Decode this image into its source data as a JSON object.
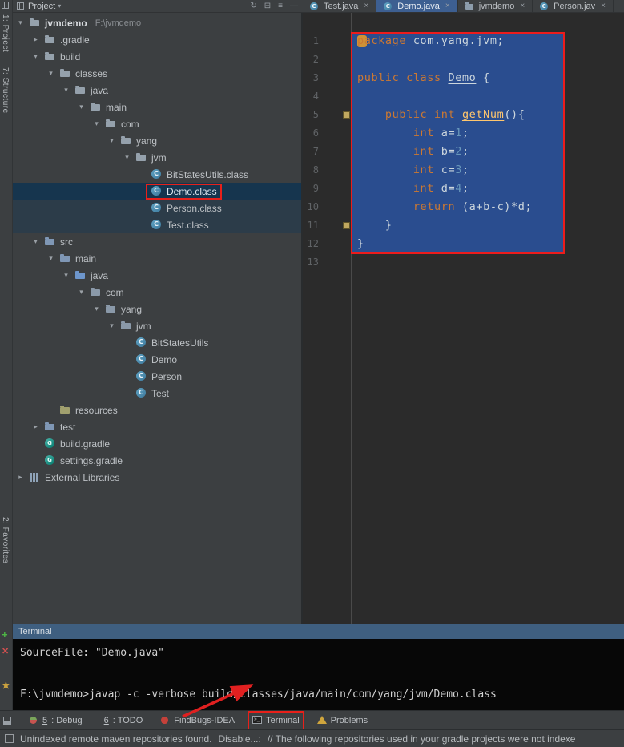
{
  "colors": {
    "accent_red": "#e8201a",
    "selection_blue": "#2a4d8f",
    "tree_selection": "#16354e",
    "keyword": "#cc7832",
    "number": "#6897bb",
    "method": "#ffc66d"
  },
  "icons": {
    "arrow_open": "▾",
    "arrow_closed": "▸"
  },
  "stripe": {
    "buttons": [
      {
        "label": "1: Project"
      },
      {
        "label": "7: Structure"
      },
      {
        "label": "2: Favorites"
      }
    ],
    "terminal_actions": [
      {
        "name": "add-icon",
        "glyph": "+"
      },
      {
        "name": "close-icon",
        "glyph": "✕"
      },
      {
        "name": "favorites-star-icon",
        "glyph": "★"
      }
    ]
  },
  "project_header": {
    "title": "Project",
    "caret": "▾",
    "actions": [
      {
        "name": "sync-icon",
        "glyph": "↻"
      },
      {
        "name": "collapse-all-icon",
        "glyph": "⊟"
      },
      {
        "name": "settings-icon",
        "glyph": "≡"
      },
      {
        "name": "hide-icon",
        "glyph": "—"
      }
    ]
  },
  "tabs": [
    {
      "label": "Test.java",
      "close": "×",
      "active": false,
      "icon": "class"
    },
    {
      "label": "Demo.java",
      "close": "×",
      "active": true,
      "icon": "class"
    },
    {
      "label": "jvmdemo",
      "close": "×",
      "active": false,
      "icon": "folder"
    },
    {
      "label": "Person.jav",
      "close": "×",
      "active": false,
      "icon": "class"
    }
  ],
  "tree": [
    {
      "label": "jvmdemo",
      "hint": "F:\\jvmdemo",
      "level": 0,
      "icon": "folder",
      "arrow": "open",
      "bold": true
    },
    {
      "label": ".gradle",
      "level": 1,
      "icon": "folder",
      "arrow": "closed"
    },
    {
      "label": "build",
      "level": 1,
      "icon": "folder",
      "arrow": "open"
    },
    {
      "label": "classes",
      "level": 2,
      "icon": "folder",
      "arrow": "open"
    },
    {
      "label": "java",
      "level": 3,
      "icon": "folder",
      "arrow": "open"
    },
    {
      "label": "main",
      "level": 4,
      "icon": "folder",
      "arrow": "open"
    },
    {
      "label": "com",
      "level": 5,
      "icon": "folder",
      "arrow": "open"
    },
    {
      "label": "yang",
      "level": 6,
      "icon": "folder",
      "arrow": "open"
    },
    {
      "label": "jvm",
      "level": 7,
      "icon": "folder",
      "arrow": "open"
    },
    {
      "label": "BitStatesUtils.class",
      "level": 8,
      "icon": "class"
    },
    {
      "label": "Demo.class",
      "level": 8,
      "icon": "class",
      "selected": true,
      "annotated": true
    },
    {
      "label": "Person.class",
      "level": 8,
      "icon": "class",
      "tinted": true
    },
    {
      "label": "Test.class",
      "level": 8,
      "icon": "class",
      "tinted": true
    },
    {
      "label": "src",
      "level": 1,
      "icon": "folder-src",
      "arrow": "open"
    },
    {
      "label": "main",
      "level": 2,
      "icon": "folder-src",
      "arrow": "open"
    },
    {
      "label": "java",
      "level": 3,
      "icon": "folder-root",
      "arrow": "open"
    },
    {
      "label": "com",
      "level": 4,
      "icon": "package",
      "arrow": "open"
    },
    {
      "label": "yang",
      "level": 5,
      "icon": "package",
      "arrow": "open"
    },
    {
      "label": "jvm",
      "level": 6,
      "icon": "package",
      "arrow": "open"
    },
    {
      "label": "BitStatesUtils",
      "level": 7,
      "icon": "class"
    },
    {
      "label": "Demo",
      "level": 7,
      "icon": "class"
    },
    {
      "label": "Person",
      "level": 7,
      "icon": "class"
    },
    {
      "label": "Test",
      "level": 7,
      "icon": "class"
    },
    {
      "label": "resources",
      "level": 2,
      "icon": "folder-resources"
    },
    {
      "label": "test",
      "level": 1,
      "icon": "folder-src",
      "arrow": "closed"
    },
    {
      "label": "build.gradle",
      "level": 1,
      "icon": "gradle"
    },
    {
      "label": "settings.gradle",
      "level": 1,
      "icon": "gradle"
    },
    {
      "label": "External Libraries",
      "level": 0,
      "icon": "library",
      "arrow": "closed"
    }
  ],
  "editor": {
    "lines": [
      {
        "n": "1",
        "segs": [
          [
            "kw",
            "package"
          ],
          [
            "pl",
            " com.yang.jvm;"
          ]
        ]
      },
      {
        "n": "2",
        "segs": []
      },
      {
        "n": "3",
        "segs": [
          [
            "kw",
            "public class"
          ],
          [
            "pl",
            " "
          ],
          [
            "cls",
            "Demo"
          ],
          [
            "pl",
            " {"
          ]
        ]
      },
      {
        "n": "4",
        "segs": []
      },
      {
        "n": "5",
        "segs": [
          [
            "pl",
            "    "
          ],
          [
            "kw",
            "public int"
          ],
          [
            "pl",
            " "
          ],
          [
            "mth",
            "getNum"
          ],
          [
            "pl",
            "(){"
          ]
        ]
      },
      {
        "n": "6",
        "segs": [
          [
            "pl",
            "        "
          ],
          [
            "kw",
            "int"
          ],
          [
            "pl",
            " a="
          ],
          [
            "num",
            "1"
          ],
          [
            "pl",
            ";"
          ]
        ]
      },
      {
        "n": "7",
        "segs": [
          [
            "pl",
            "        "
          ],
          [
            "kw",
            "int"
          ],
          [
            "pl",
            " b="
          ],
          [
            "num",
            "2"
          ],
          [
            "pl",
            ";"
          ]
        ]
      },
      {
        "n": "8",
        "segs": [
          [
            "pl",
            "        "
          ],
          [
            "kw",
            "int"
          ],
          [
            "pl",
            " c="
          ],
          [
            "num",
            "3"
          ],
          [
            "pl",
            ";"
          ]
        ]
      },
      {
        "n": "9",
        "segs": [
          [
            "pl",
            "        "
          ],
          [
            "kw",
            "int"
          ],
          [
            "pl",
            " d="
          ],
          [
            "num",
            "4"
          ],
          [
            "pl",
            ";"
          ]
        ]
      },
      {
        "n": "10",
        "segs": [
          [
            "pl",
            "        "
          ],
          [
            "kw",
            "return"
          ],
          [
            "pl",
            " (a+b-c)*d;"
          ]
        ]
      },
      {
        "n": "11",
        "segs": [
          [
            "pl",
            "    }"
          ]
        ]
      },
      {
        "n": "12",
        "segs": [
          [
            "pl",
            "}"
          ]
        ]
      },
      {
        "n": "13",
        "segs": []
      }
    ]
  },
  "terminal": {
    "title": "Terminal",
    "lines": [
      "SourceFile: \"Demo.java\"",
      "",
      "F:\\jvmdemo>javap -c -verbose build/classes/java/main/com/yang/jvm/Demo.class"
    ]
  },
  "bottom_toolbar": {
    "items": [
      {
        "key": "5",
        "label": ": Debug",
        "icon": "debug-icon"
      },
      {
        "key": "6",
        "label": ": TODO",
        "icon": "todo-icon"
      },
      {
        "key": "",
        "label": "FindBugs-IDEA",
        "icon": "findbugs-icon"
      },
      {
        "key": "",
        "label": "Terminal",
        "icon": "terminal-icon",
        "annotated": true
      },
      {
        "key": "",
        "label": "Problems",
        "icon": "problems-icon"
      }
    ]
  },
  "status_bar": {
    "message": "Unindexed remote maven repositories found.",
    "link": "Disable...:",
    "detail": "// The following repositories used in your gradle projects were not indexe"
  }
}
